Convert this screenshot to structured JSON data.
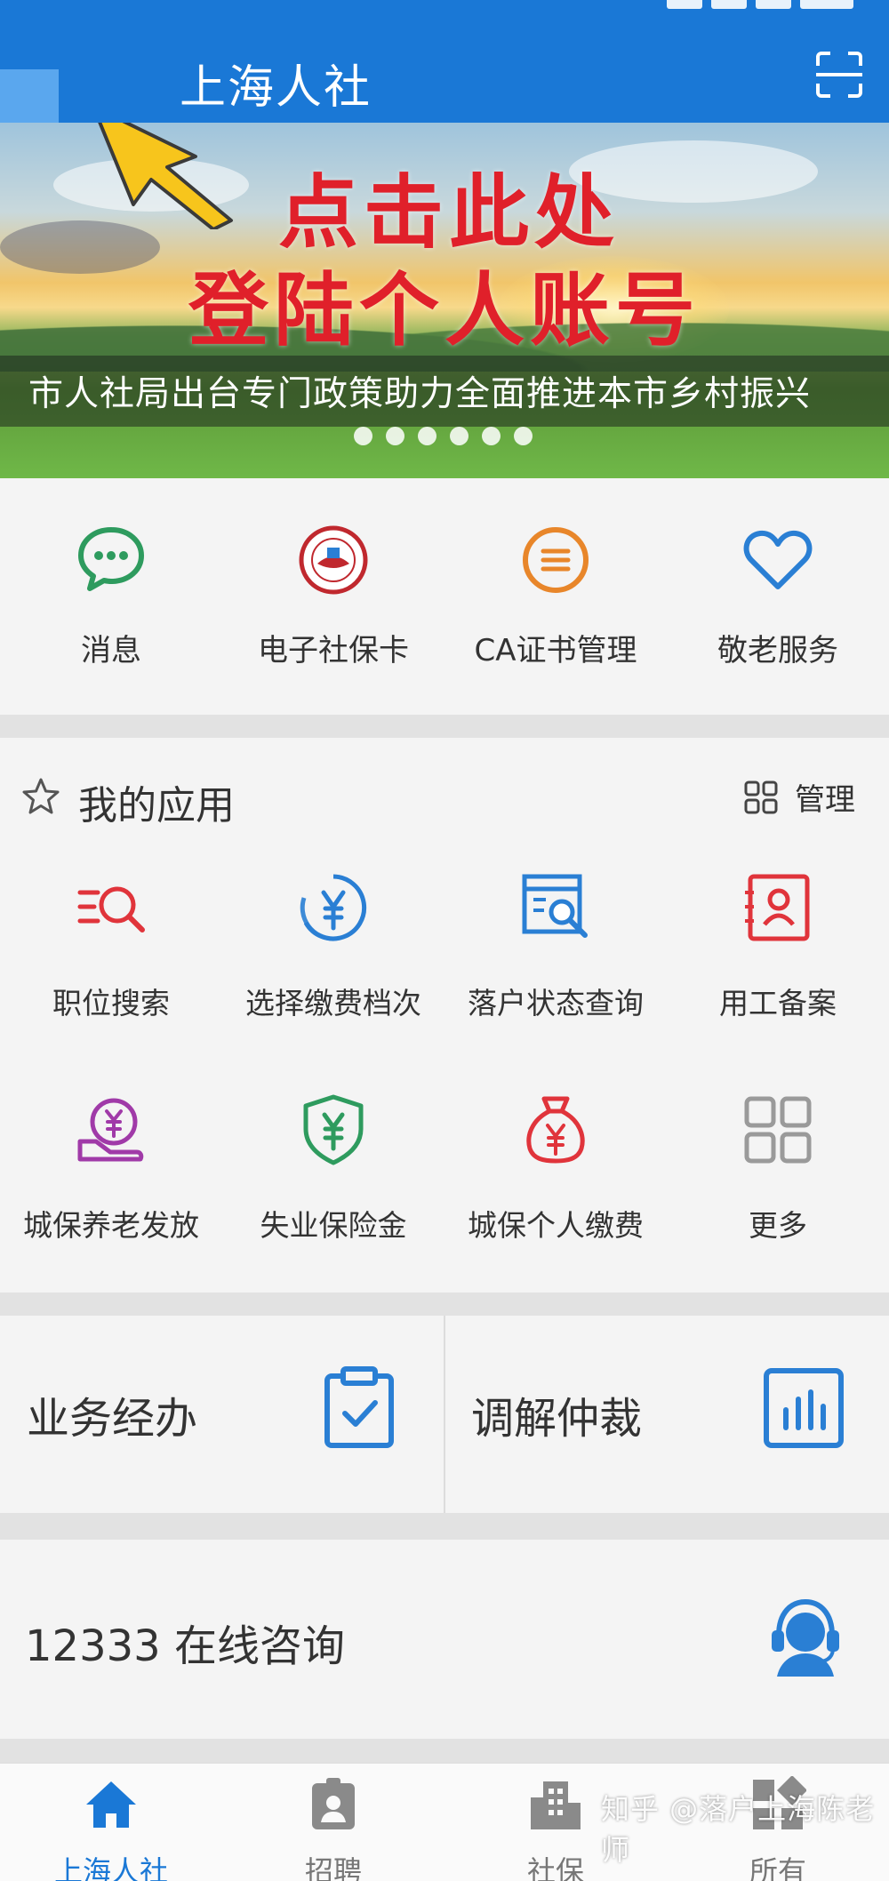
{
  "header": {
    "title": "上海人社",
    "scan_icon": "scan-icon",
    "color": "#1a78d6"
  },
  "banner": {
    "promo_line1": "点击此处",
    "promo_line2": "登陆个人账号",
    "caption": "市人社局出台专门政策助力全面推进本市乡村振兴",
    "dot_count": 6
  },
  "quick_actions": [
    {
      "label": "消息",
      "icon": "chat-bubble-icon",
      "color": "#2e9b5e"
    },
    {
      "label": "电子社保卡",
      "icon": "social-security-card-icon",
      "color": "#c0282e"
    },
    {
      "label": "CA证书管理",
      "icon": "list-circle-icon",
      "color": "#e8862a"
    },
    {
      "label": "敬老服务",
      "icon": "heart-icon",
      "color": "#2a7fd4"
    }
  ],
  "my_apps": {
    "title": "我的应用",
    "manage_label": "管理",
    "items": [
      {
        "label": "职位搜索",
        "icon": "job-search-icon",
        "color": "#e0343b"
      },
      {
        "label": "选择缴费档次",
        "icon": "yuan-cycle-icon",
        "color": "#2a7fd4"
      },
      {
        "label": "落户状态查询",
        "icon": "document-search-icon",
        "color": "#2a7fd4"
      },
      {
        "label": "用工备案",
        "icon": "employee-card-icon",
        "color": "#e0343b"
      },
      {
        "label": "城保养老发放",
        "icon": "yuan-hand-icon",
        "color": "#a03aa8"
      },
      {
        "label": "失业保险金",
        "icon": "yuan-shield-icon",
        "color": "#2e9b5e"
      },
      {
        "label": "城保个人缴费",
        "icon": "money-bag-icon",
        "color": "#e0343b"
      },
      {
        "label": "更多",
        "icon": "grid-more-icon",
        "color": "#9a9a9a"
      }
    ]
  },
  "services": {
    "business": {
      "label": "业务经办",
      "icon": "clipboard-check-icon"
    },
    "mediation": {
      "label": "调解仲裁",
      "icon": "bar-chart-icon"
    }
  },
  "consult": {
    "label": "12333 在线咨询",
    "icon": "headset-agent-icon"
  },
  "tabbar": {
    "tabs": [
      {
        "label": "上海人社",
        "icon": "home-icon",
        "active": true
      },
      {
        "label": "招聘",
        "icon": "badge-icon",
        "active": false
      },
      {
        "label": "社保",
        "icon": "building-icon",
        "active": false
      },
      {
        "label": "所有",
        "icon": "apps-icon",
        "active": false
      }
    ]
  },
  "watermark": "知乎 @落户上海陈老师"
}
